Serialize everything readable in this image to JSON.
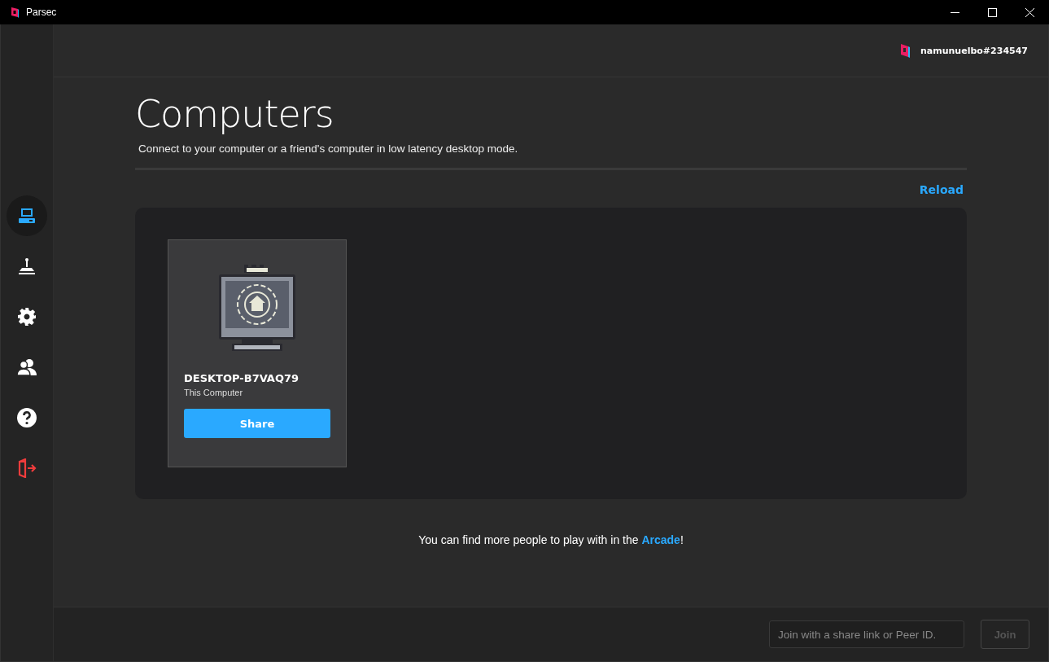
{
  "window": {
    "title": "Parsec"
  },
  "sidebar": {
    "items": [
      {
        "kind": "computers",
        "selected": true
      },
      {
        "kind": "arcade",
        "selected": false
      },
      {
        "kind": "settings",
        "selected": false
      },
      {
        "kind": "friends",
        "selected": false
      },
      {
        "kind": "help",
        "selected": false
      },
      {
        "kind": "logout",
        "selected": false
      }
    ]
  },
  "user": {
    "name": "namunuelbo#234547"
  },
  "page": {
    "title": "Computers",
    "subtitle": "Connect to your computer or a friend's computer in low latency desktop mode.",
    "reload": "Reload"
  },
  "computers": [
    {
      "name": "DESKTOP-B7VAQ79",
      "label": "This Computer",
      "button": "Share"
    }
  ],
  "arcade_note": {
    "before": "You can find more people to play with in the ",
    "link": "Arcade",
    "after": "!"
  },
  "footer": {
    "placeholder": "Join with a share link or Peer ID.",
    "button": "Join",
    "button_disabled": true
  }
}
